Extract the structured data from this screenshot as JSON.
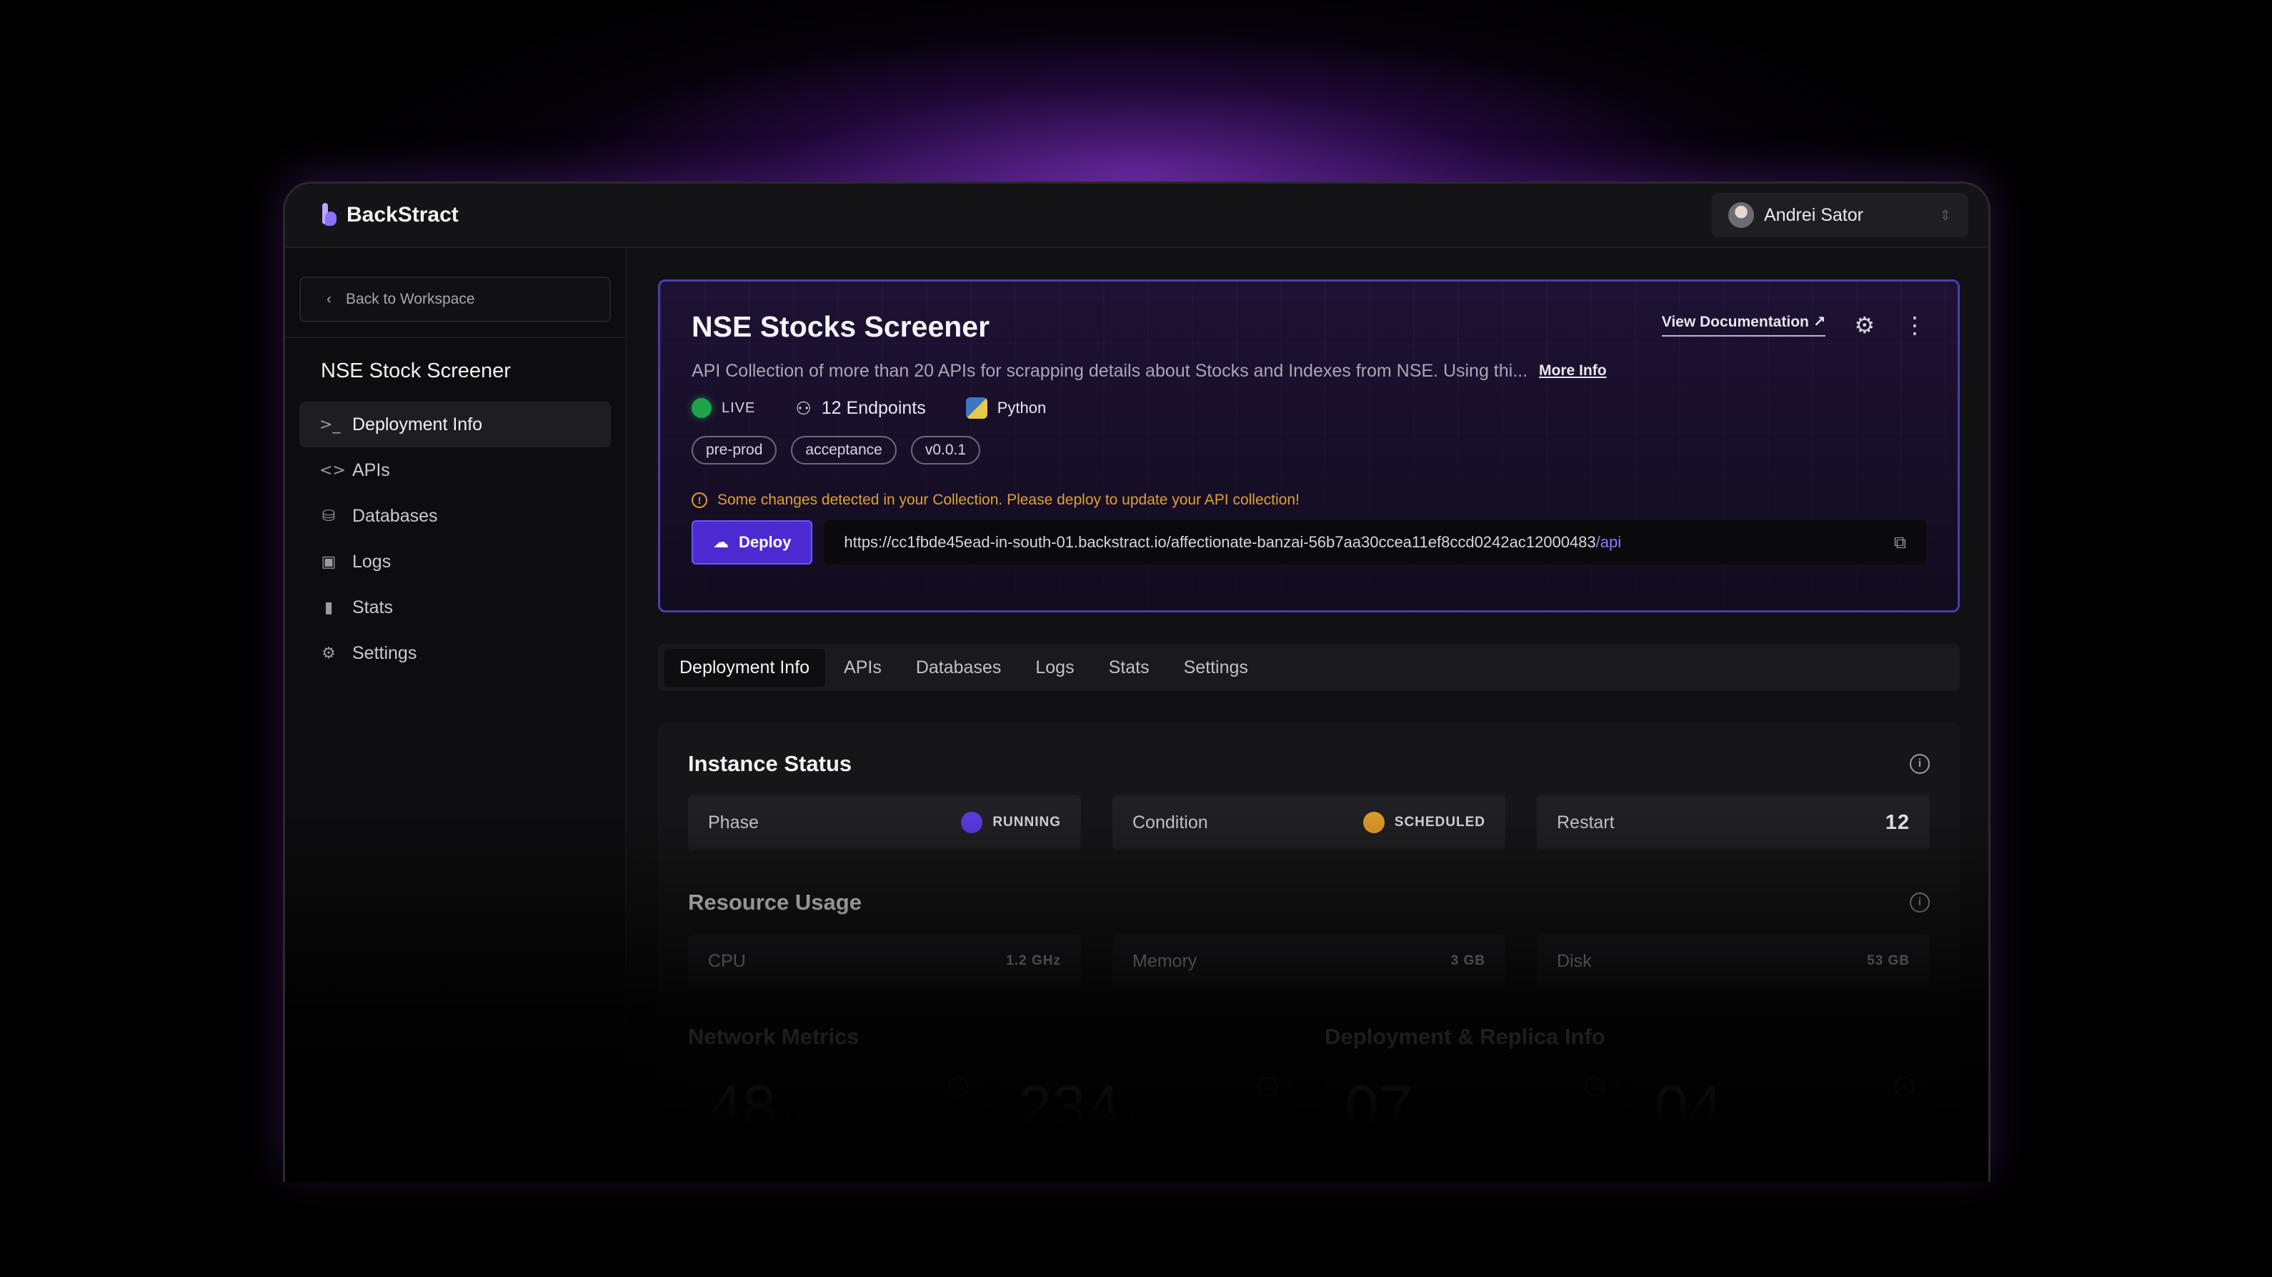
{
  "app": {
    "name": "BackStract"
  },
  "user": {
    "name": "Andrei Sator"
  },
  "sidebar": {
    "back_label": "Back to Workspace",
    "project_name": "NSE Stock Screener",
    "items": [
      {
        "label": "Deployment Info",
        "icon": "terminal-icon"
      },
      {
        "label": "APIs",
        "icon": "code-icon"
      },
      {
        "label": "Databases",
        "icon": "database-icon"
      },
      {
        "label": "Logs",
        "icon": "logs-icon"
      },
      {
        "label": "Stats",
        "icon": "bar-chart-icon"
      },
      {
        "label": "Settings",
        "icon": "gear-icon"
      }
    ]
  },
  "hero": {
    "title": "NSE Stocks Screener",
    "doc_link": "View Documentation",
    "description": "API Collection of more than 20 APIs for scrapping details about Stocks and Indexes from NSE. Using thi...",
    "more_info": "More Info",
    "status": "LIVE",
    "endpoints": "12 Endpoints",
    "language": "Python",
    "tags": [
      "pre-prod",
      "acceptance",
      "v0.0.1"
    ],
    "warning": "Some changes detected in your Collection. Please deploy to update your API collection!",
    "deploy_label": "Deploy",
    "url_base": "https://cc1fbde45ead-in-south-01.backstract.io/affectionate-banzai-56b7aa30ccea11ef8ccd0242ac12000483",
    "url_suffix": "/api"
  },
  "tabs": [
    "Deployment Info",
    "APIs",
    "Databases",
    "Logs",
    "Stats",
    "Settings"
  ],
  "instance_status": {
    "title": "Instance Status",
    "phase_label": "Phase",
    "phase_value": "RUNNING",
    "condition_label": "Condition",
    "condition_value": "SCHEDULED",
    "restart_label": "Restart",
    "restart_value": "12"
  },
  "resource_usage": {
    "title": "Resource Usage",
    "cpu_label": "CPU",
    "cpu_value": "1.2 GHz",
    "memory_label": "Memory",
    "memory_value": "3 GB",
    "disk_label": "Disk",
    "disk_value": "53 GB"
  },
  "network_metrics": {
    "title": "Network Metrics",
    "m1_value": "48",
    "m1_unit": "MB",
    "m2_value": "234",
    "m2_unit": "K"
  },
  "replica_info": {
    "title": "Deployment & Replica Info",
    "r1_value": "07",
    "r2_value": "04"
  },
  "colors": {
    "accent": "#4b2bd1",
    "live": "#1fa34a",
    "running": "#5a3be0",
    "scheduled": "#e09a2a",
    "warning": "#e0a032"
  }
}
